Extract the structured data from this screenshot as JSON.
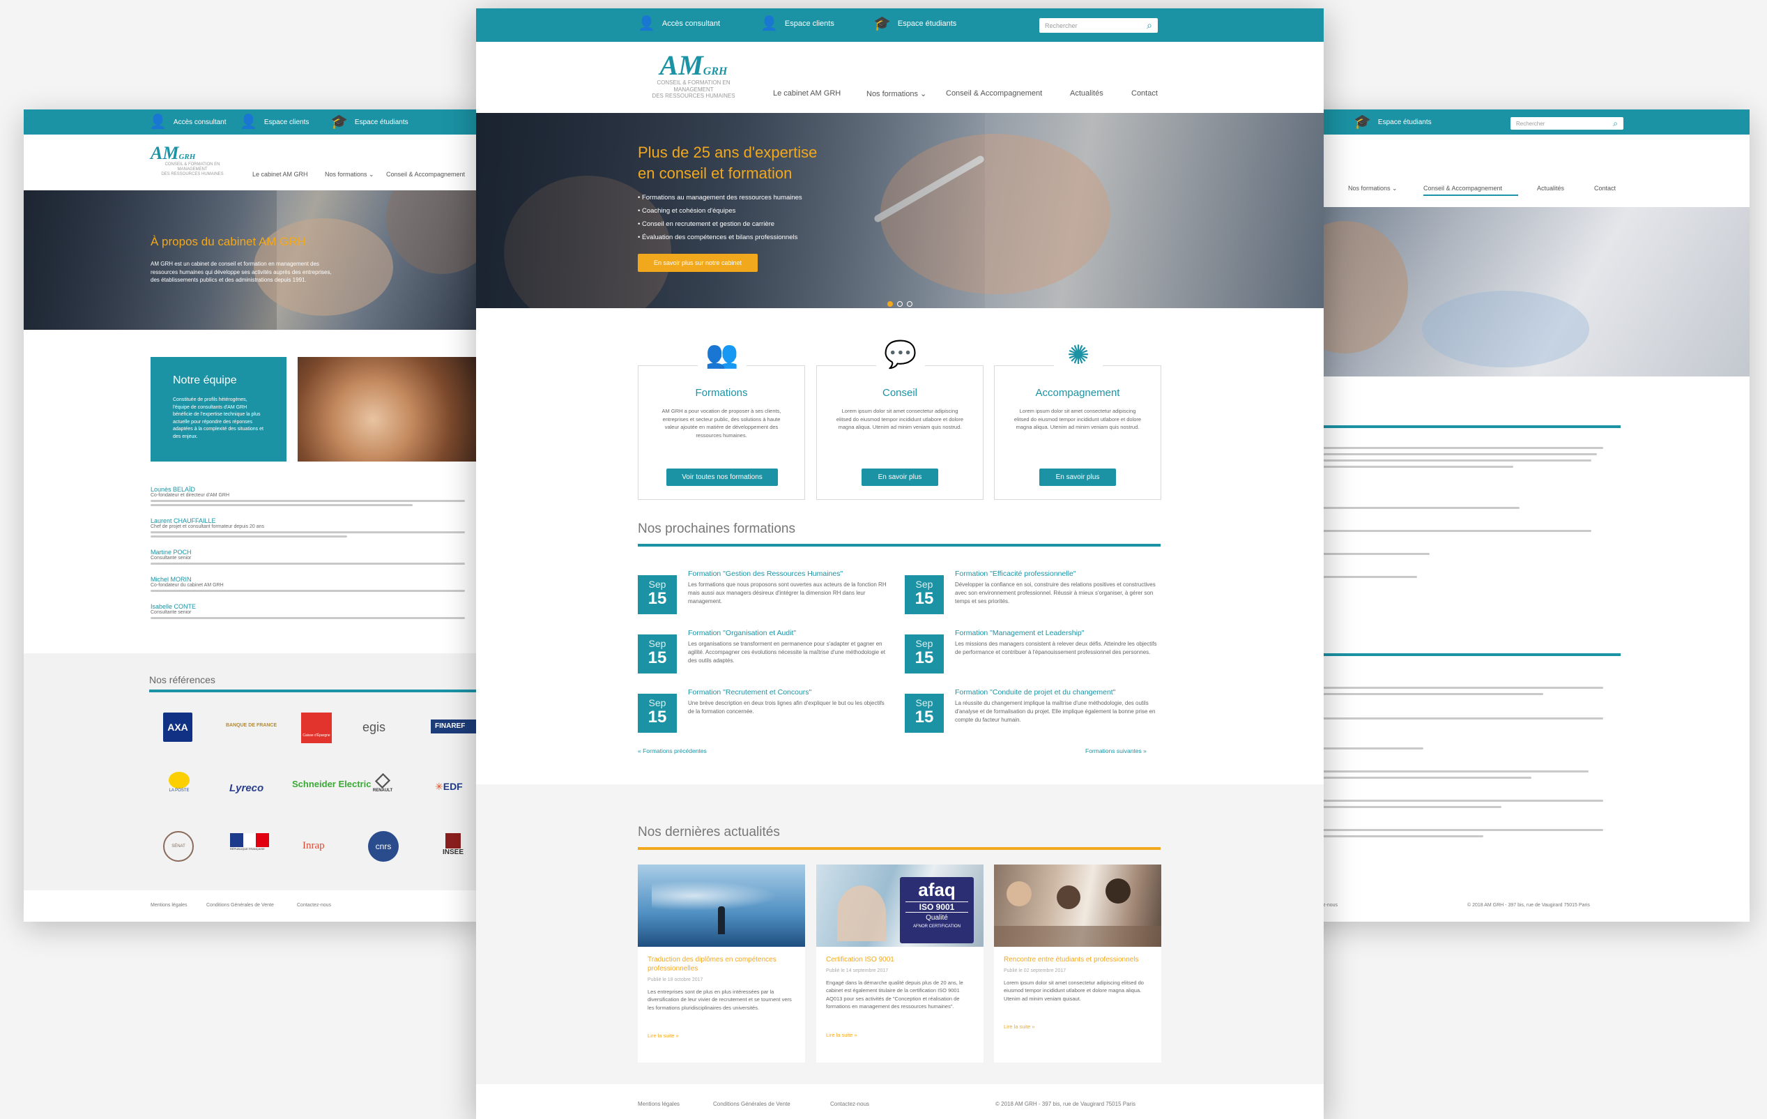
{
  "topbar": {
    "acces_consultant": "Accès consultant",
    "espace_clients": "Espace clients",
    "espace_etudiants": "Espace étudiants",
    "search_placeholder": "Rechercher"
  },
  "logo": {
    "mark": "AM",
    "grh": "GRH",
    "tagline_1": "CONSEIL & FORMATION EN MANAGEMENT",
    "tagline_2": "DES RESSOURCES HUMAINES"
  },
  "nav": {
    "cabinet": "Le cabinet AM GRH",
    "formations": "Nos formations",
    "conseil": "Conseil & Accompagnement",
    "actualites": "Actualités",
    "contact": "Contact"
  },
  "hero": {
    "title_1": "Plus de 25 ans d'expertise",
    "title_2": "en conseil et formation",
    "bullets": [
      "Formations au management des ressources humaines",
      "Coaching et cohésion d'équipes",
      "Conseil en recrutement et gestion de carrière",
      "Évaluation des compétences et bilans professionnels"
    ],
    "cta": "En savoir plus sur notre cabinet"
  },
  "cards": [
    {
      "title": "Formations",
      "text": "AM GRH a pour vocation de proposer à ses clients, entreprises et secteur public, des solutions à haute valeur ajoutée en matière de développement des ressources humaines.",
      "button": "Voir toutes nos formations"
    },
    {
      "title": "Conseil",
      "text": "Lorem ipsum dolor sit amet consectetur adipiscing elitsed do eiusmod tempor incididunt utlabore et dolore magna aliqua. Utenim ad minim veniam quis nostrud.",
      "button": "En savoir plus"
    },
    {
      "title": "Accompagnement",
      "text": "Lorem ipsum dolor sit amet consectetur adipiscing elitsed do eiusmod tempor incididunt utlabore et dolore magna aliqua. Utenim ad minim veniam quis nostrud.",
      "button": "En savoir plus"
    }
  ],
  "formations": {
    "heading": "Nos prochaines formations",
    "items": [
      {
        "month": "Sep",
        "day": "15",
        "title": "Formation \"Gestion des Ressources Humaines\"",
        "text": "Les formations que nous proposons sont ouvertes aux acteurs de la fonction RH mais aussi aux managers désireux d'intégrer la dimension RH dans leur management."
      },
      {
        "month": "Sep",
        "day": "15",
        "title": "Formation \"Efficacité professionnelle\"",
        "text": "Développer la confiance en soi, construire des relations positives et constructives avec son environnement professionnel. Réussir à mieux s'organiser, à gérer son temps et ses priorités."
      },
      {
        "month": "Sep",
        "day": "15",
        "title": "Formation \"Organisation et Audit\"",
        "text": "Les organisations se transforment en permanence pour s'adapter et gagner en agilité. Accompagner ces évolutions nécessite la maîtrise d'une méthodologie et des outils adaptés."
      },
      {
        "month": "Sep",
        "day": "15",
        "title": "Formation \"Management et Leadership\"",
        "text": "Les missions des managers consistent à relever deux défis. Atteindre les objectifs de performance et contribuer à l'épanouissement professionnel des personnes."
      },
      {
        "month": "Sep",
        "day": "15",
        "title": "Formation \"Recrutement et Concours\"",
        "text": "Une brève description en deux trois lignes afin d'expliquer le but ou les objectifs de la formation concernée."
      },
      {
        "month": "Sep",
        "day": "15",
        "title": "Formation \"Conduite de projet et du changement\"",
        "text": "La réussite du changement implique la maîtrise d'une méthodologie, des outils d'analyse et de formalisation du projet. Elle implique également la bonne prise en compte du facteur humain."
      }
    ],
    "prev": "« Formations précédentes",
    "next": "Formations suivantes »"
  },
  "actus": {
    "heading": "Nos dernières actualités",
    "items": [
      {
        "title": "Traduction des diplômes en compétences professionnelles",
        "date": "Publié le 18 octobre 2017",
        "text": "Les entreprises sont de plus en plus intéressées par la diversification de leur vivier de recrutement et se tournent vers les formations pluridisciplinaires des universités.",
        "more": "Lire la suite »"
      },
      {
        "title": "Certification ISO 9001",
        "date": "Publié le 14 septembre 2017",
        "text": "Engagé dans la démarche qualité depuis plus de 20 ans, le cabinet est également titulaire de la certification ISO 9001 AQ013 pour ses activités de \"Conception et réalisation de formations en management des ressources humaines\".",
        "more": "Lire la suite »"
      },
      {
        "title": "Rencontre entre étudiants et professionnels",
        "date": "Publié le 02 septembre 2017",
        "text": "Lorem ipsum dolor sit amet consectetur adipiscing elitsed do eiusmod tempor incididunt utlabore et dolore magna aliqua. Utenim ad minim veniam quisaut.",
        "more": "Lire la suite »"
      }
    ],
    "afaq": {
      "brand": "afaq",
      "iso": "ISO 9001",
      "qual": "Qualité",
      "cert": "AFNOR CERTIFICATION"
    }
  },
  "footer": {
    "mentions": "Mentions légales",
    "cgv": "Conditions Générales de Vente",
    "contact": "Contactez-nous",
    "copyright": "© 2018 AM GRH - 397 bis, rue de Vaugirard 75015 Paris"
  },
  "left_page": {
    "about_title": "À propos du cabinet AM GRH",
    "about_text": "AM GRH est un cabinet de conseil et formation en management des ressources humaines qui développe ses activités auprès des entreprises, des établissements publics et des administrations depuis 1991.",
    "team_title": "Notre équipe",
    "team_text": "Constituée de profils hétérogènes, l'équipe de consultants d'AM GRH bénéficie de l'expertise technique la plus actuelle pour répondre des réponses adaptées à la complexité des situations et des enjeux.",
    "members": [
      {
        "name": "Lounès BELAÏD",
        "role": "Co-fondateur et directeur d'AM GRH"
      },
      {
        "name": "Laurent CHAUFFAILLE",
        "role": "Chef de projet et consultant formateur depuis 20 ans"
      },
      {
        "name": "Martine POCH",
        "role": "Consultante senior"
      },
      {
        "name": "Michel MORIN",
        "role": "Co-fondateur du cabinet AM GRH"
      },
      {
        "name": "Isabelle CONTE",
        "role": "Consultante senior"
      }
    ],
    "references_title": "Nos références",
    "logos": [
      "AXA",
      "BANQUE DE FRANCE",
      "Caisse d'Épargne",
      "egis",
      "FINAREF",
      "LA POSTE",
      "Lyreco",
      "Schneider Electric",
      "RENAULT",
      "EDF",
      "SÉNAT",
      "RÉPUBLIQUE FRANÇAISE",
      "Inrap",
      "cnrs",
      "INSEE"
    ]
  },
  "colors": {
    "teal": "#1b93a4",
    "orange": "#f2a81d",
    "gray_bg": "#f4f4f4"
  }
}
